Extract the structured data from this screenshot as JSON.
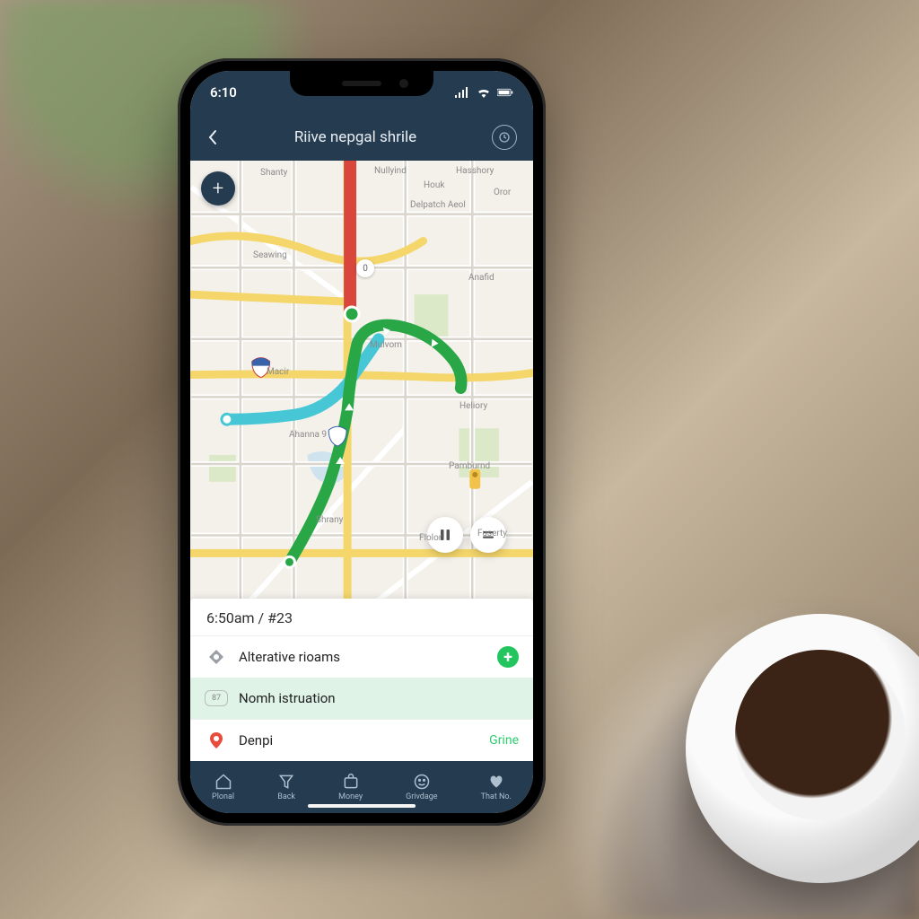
{
  "status": {
    "time": "6:10"
  },
  "header": {
    "title": "Riive nepgal shrile"
  },
  "map": {
    "fab_plus": "+",
    "marker_label": "0",
    "control_a": "▯▯",
    "control_b": "=",
    "places": {
      "shanty": "Shanty",
      "nullyind": "Nullyind",
      "hasshory": "Hasshory",
      "houk": "Houk",
      "delpatch": "Delpatch Aeol",
      "oror": "Oror",
      "seawing": "Seawing",
      "macir": "Macir",
      "mulvom": "Mulvom",
      "ahanna": "Ahanna 9",
      "heiory": "Heliory",
      "pambund": "Pamburnd",
      "shrany": "Shrany",
      "fiolor": "Fiolor",
      "fuserty": "Fuserty",
      "anafid": "Anafid"
    }
  },
  "sheet": {
    "time_line": "6:50am / #23",
    "alt_label": "Alterative rioams",
    "nomh_label": "Nomh istruation",
    "nomh_badge": "87",
    "denpi_label": "Denpi",
    "denpi_trail": "Grine"
  },
  "nav": {
    "plonal": "Plonal",
    "back": "Back",
    "money": "Money",
    "grivdage": "Grivdage",
    "thatno": "That No."
  }
}
